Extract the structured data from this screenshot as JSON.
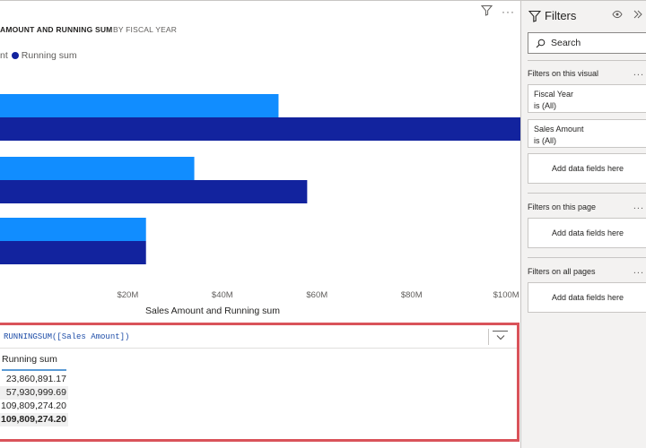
{
  "visual_header": {
    "filter_icon": "funnel-icon",
    "more_icon": "ellipsis-icon"
  },
  "chart": {
    "title": "AMOUNT AND RUNNING SUM",
    "subtitle": "BY FISCAL YEAR",
    "legend": [
      {
        "label": "nt",
        "color": "#118dff"
      },
      {
        "label": "Running sum",
        "color": "#12239e"
      }
    ]
  },
  "chart_data": {
    "type": "bar",
    "orientation": "horizontal",
    "title": "AMOUNT AND RUNNING SUM",
    "subtitle": "BY FISCAL YEAR",
    "xlabel": "Sales Amount and Running sum",
    "ylabel": "",
    "xlim": [
      -7000000,
      103000000
    ],
    "xticks": [
      {
        "label": "$20M",
        "value": 20000000
      },
      {
        "label": "$40M",
        "value": 40000000
      },
      {
        "label": "$60M",
        "value": 60000000
      },
      {
        "label": "$80M",
        "value": 80000000
      },
      {
        "label": "$100M",
        "value": 100000000
      }
    ],
    "categories": [
      "",
      "",
      ""
    ],
    "series": [
      {
        "name": "nt",
        "color": "#118dff",
        "values": [
          51878383.03,
          34070108.52,
          23860891.17
        ]
      },
      {
        "name": "Running sum",
        "color": "#12239e",
        "values": [
          109809274.2,
          57930999.69,
          23860891.17
        ]
      }
    ],
    "grid": false,
    "legend_position": "top-left"
  },
  "query": {
    "formula": "RUNNINGSUM([Sales Amount])",
    "column_header": "Running sum",
    "rows": [
      "23,860,891.17",
      "57,930,999.69",
      "109,809,274.20"
    ],
    "total": "109,809,274.20"
  },
  "filters": {
    "title": "Filters",
    "search_placeholder": "Search",
    "on_visual_label": "Filters on this visual",
    "cards": [
      {
        "name": "Fiscal Year",
        "state": "is (All)"
      },
      {
        "name": "Sales Amount",
        "state": "is (All)"
      }
    ],
    "add_fields": "Add data fields here",
    "on_page_label": "Filters on this page",
    "on_all_pages_label": "Filters on all pages",
    "more": "..."
  }
}
